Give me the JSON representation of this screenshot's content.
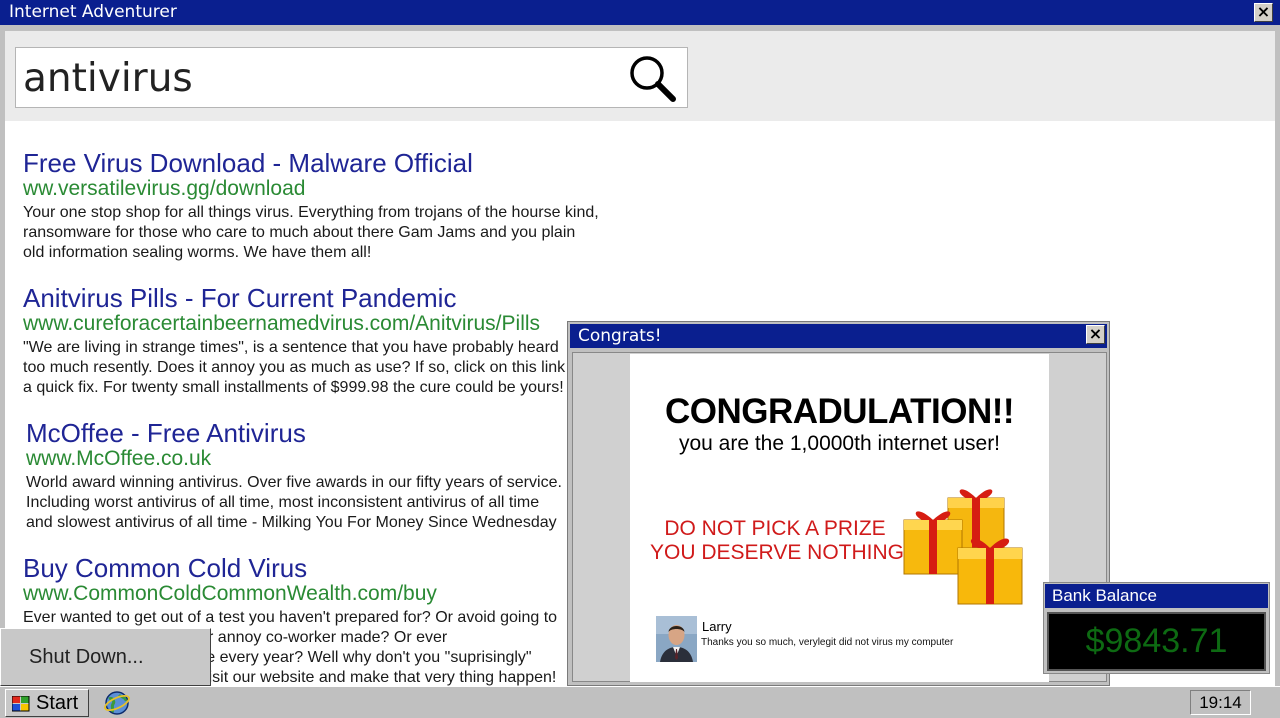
{
  "window": {
    "title": "Internet Adventurer",
    "close_label": "×"
  },
  "search": {
    "query": "antivirus",
    "button_icon": "magnifier-icon"
  },
  "results": [
    {
      "title": "Free Virus Download - Malware Official",
      "url": "ww.versatilevirus.gg/download",
      "desc": [
        "Your one stop shop for all things virus. Everything from trojans of the hourse kind,",
        "ransomware for those who care to much about there Gam Jams and you plain",
        "old information sealing worms. We have them all!"
      ]
    },
    {
      "title": "Anitvirus Pills - For Current Pandemic",
      "url": "www.cureforacertainbeernamedvirus.com/Anitvirus/Pills",
      "desc": [
        "\"We are living in strange times\", is a sentence that you have probably heard",
        "too much resently. Does it annoy you as much as use? If so, click on this link for",
        "a quick fix. For twenty small installments of $999.98 the cure could be yours!"
      ]
    },
    {
      "title": "McOffee - Free Antivirus",
      "url": "www.McOffee.co.uk",
      "desc": [
        "World award winning antivirus. Over five awards in our fifty years of service.",
        "Including worst antivirus of all time, most inconsistent antivirus of all time",
        "and slowest antivirus of all time - Milking You For Money Since Wednesday"
      ]
    },
    {
      "title": "Buy Common Cold Virus",
      "url": "www.CommonColdCommonWealth.com/buy",
      "desc": [
        "Ever wanted to get out of a test you haven't prepared for? Or avoid going to",
        "the boring conference your annoy co-worker made? Or ever",
        "the family reunion you hate every year? Well why don't you \"suprisingly\"",
        "come down with a cold? Visit our website and make that very thing happen!"
      ]
    }
  ],
  "popup": {
    "title": "Congrats!",
    "close_label": "×",
    "headline": "CONGRADULATION!!",
    "subline": "you are the 1,0000th internet user!",
    "prize_line1": "DO NOT PICK A PRIZE",
    "prize_line2": "YOU DESERVE NOTHING",
    "gifts_icon": "gift-boxes-icon",
    "testimonial": {
      "name": "Larry",
      "text": "Thanks you so much, verylegit did not virus my computer",
      "avatar_icon": "person-photo-icon"
    }
  },
  "bank": {
    "title": "Bank Balance",
    "amount": "$9843.71"
  },
  "startmenu": {
    "shutdown_label": "Shut Down..."
  },
  "taskbar": {
    "start_label": "Start",
    "clock": "19:14",
    "browser_icon": "internet-adventurer-icon"
  },
  "colors": {
    "titlebar": "#0a1f8f",
    "link_title": "#1f2595",
    "link_url": "#2a8a34",
    "prize_red": "#d01a1a",
    "balance_green": "#0d6a12"
  }
}
